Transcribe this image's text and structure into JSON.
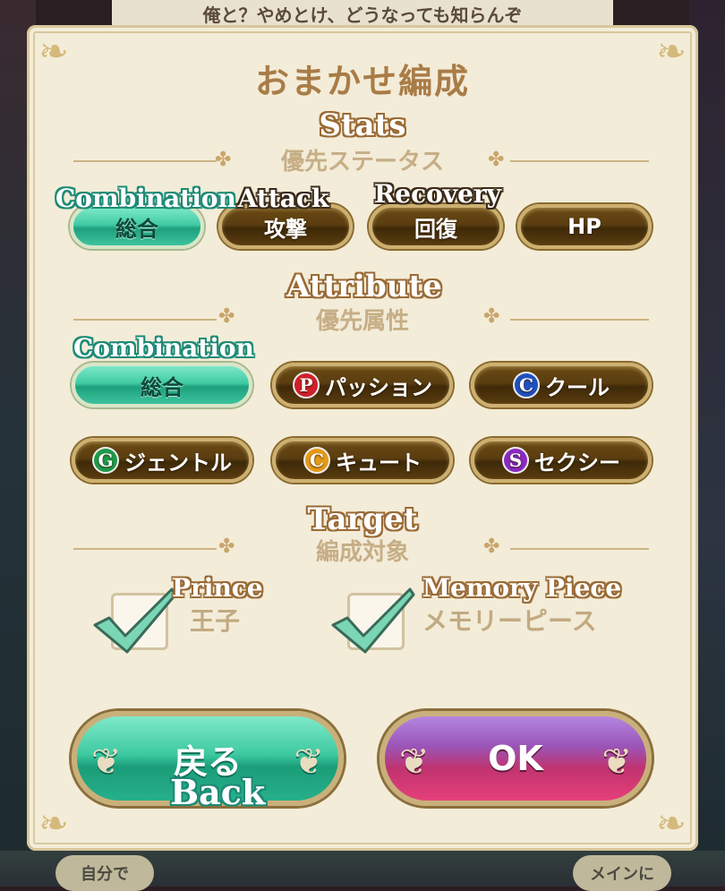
{
  "background": {
    "top_banner": "俺と？やめとけ、どうなっても知らんぞ",
    "bottom_left_chip": "自分で",
    "bottom_right_chip": "メインに"
  },
  "dialog": {
    "title": "おまかせ編成",
    "overlays": {
      "stats": "Stats",
      "combination_1": "Combination",
      "attack": "Attack",
      "recovery": "Recovery",
      "attribute": "Attribute",
      "combination_2": "Combination",
      "target": "Target",
      "prince": "Prince",
      "memory_piece": "Memory Piece",
      "back": "Back"
    },
    "stats_section": {
      "label": "優先ステータス",
      "buttons": [
        {
          "label": "総合",
          "selected": true
        },
        {
          "label": "攻撃",
          "selected": false
        },
        {
          "label": "回復",
          "selected": false
        },
        {
          "label": "HP",
          "selected": false
        }
      ]
    },
    "attribute_section": {
      "label": "優先属性",
      "buttons": [
        {
          "label": "総合",
          "selected": true,
          "orb": ""
        },
        {
          "label": "パッション",
          "selected": false,
          "orb": "P",
          "orb_color": "#d0202a"
        },
        {
          "label": "クール",
          "selected": false,
          "orb": "C",
          "orb_color": "#2050c0"
        },
        {
          "label": "ジェントル",
          "selected": false,
          "orb": "G",
          "orb_color": "#1e9a4a"
        },
        {
          "label": "キュート",
          "selected": false,
          "orb": "C",
          "orb_color": "#e59a18"
        },
        {
          "label": "セクシー",
          "selected": false,
          "orb": "S",
          "orb_color": "#8a2ac0"
        }
      ]
    },
    "target_section": {
      "label": "編成対象",
      "options": [
        {
          "label": "王子",
          "checked": true
        },
        {
          "label": "メモリーピース",
          "checked": true
        }
      ]
    },
    "actions": {
      "back_label": "戻る",
      "ok_label": "OK"
    }
  }
}
